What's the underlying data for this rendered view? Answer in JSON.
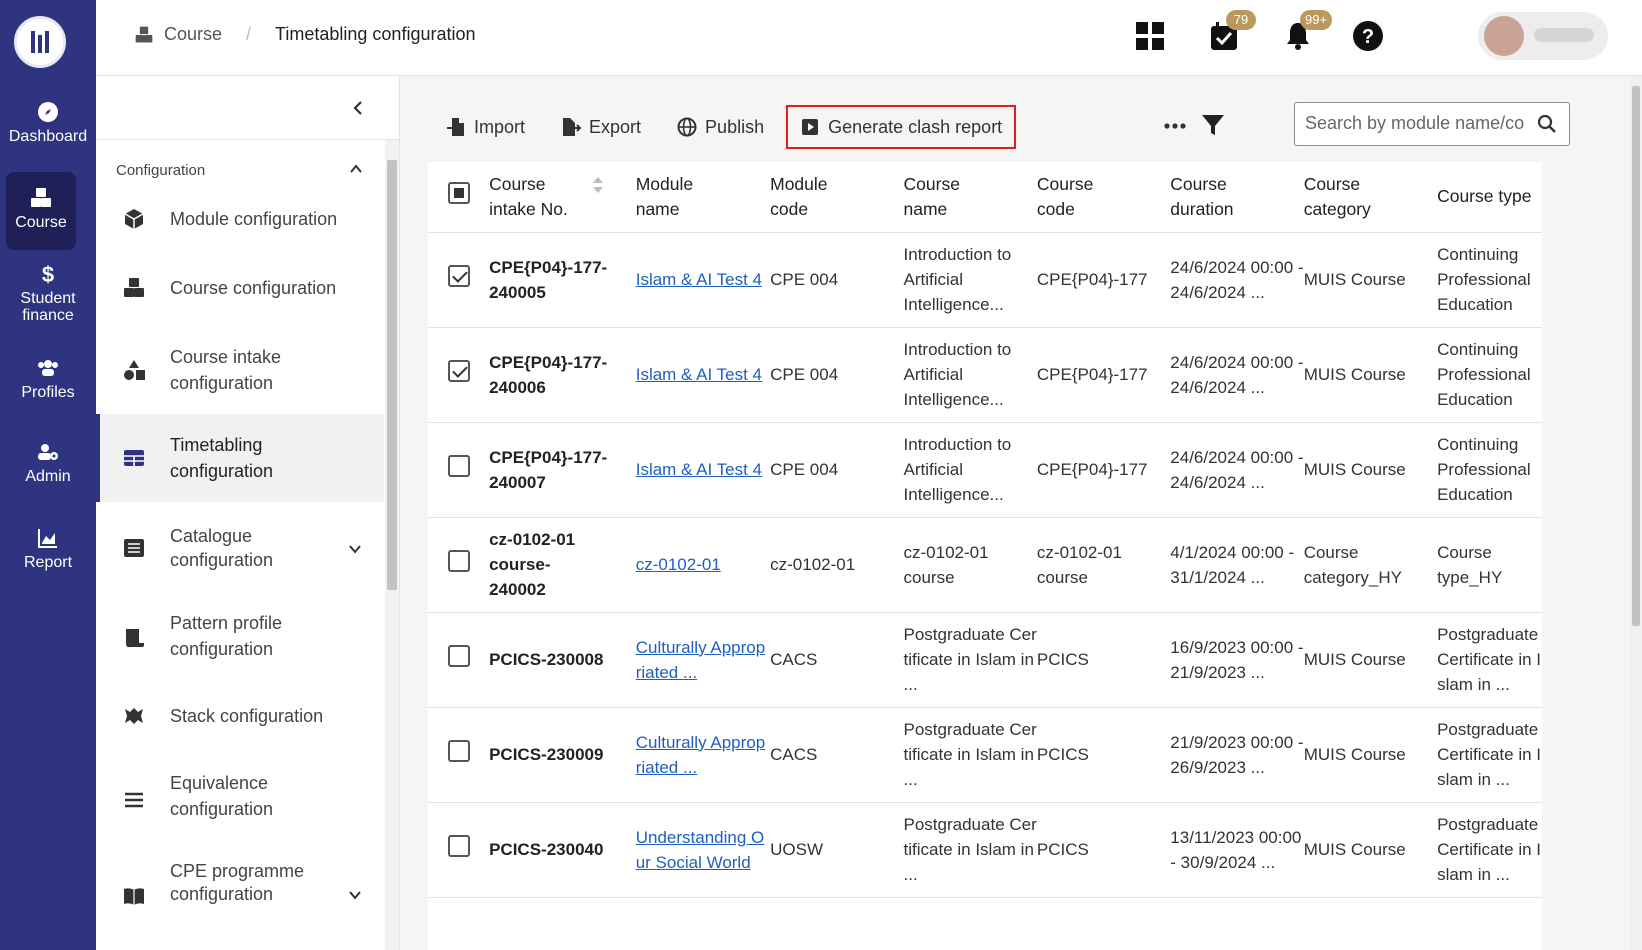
{
  "rail": {
    "items": [
      {
        "label": "Dashboard"
      },
      {
        "label": "Course"
      },
      {
        "label": "Student finance"
      },
      {
        "label": "Profiles"
      },
      {
        "label": "Admin"
      },
      {
        "label": "Report"
      }
    ]
  },
  "header": {
    "breadcrumb": [
      "Course",
      "Timetabling configuration"
    ],
    "calendar_badge": "79",
    "notification_badge": "99+"
  },
  "sidebar": {
    "section_title": "Configuration",
    "items": [
      {
        "label": "Module configuration"
      },
      {
        "label": "Course configuration"
      },
      {
        "label": "Course intake configuration"
      },
      {
        "label": "Timetabling configuration"
      },
      {
        "label": "Catalogue configuration"
      },
      {
        "label": "Pattern profile configuration"
      },
      {
        "label": "Stack configuration"
      },
      {
        "label": "Equivalence configuration"
      },
      {
        "label": "CPE programme configuration"
      }
    ]
  },
  "toolbar": {
    "import_label": "Import",
    "export_label": "Export",
    "publish_label": "Publish",
    "clash_label": "Generate clash report",
    "search_placeholder": "Search by module name/co..."
  },
  "table": {
    "columns": [
      "Course intake No.",
      "Module name",
      "Module code",
      "Course name",
      "Course code",
      "Course duration",
      "Course category",
      "Course type"
    ],
    "rows": [
      {
        "checked": true,
        "intake": "CPE{P04}-177-240005",
        "module_name": "Islam & AI Test 4",
        "module_code": "CPE 004",
        "course_name": "Introduction to Artificial Intelligence...",
        "course_code": "CPE{P04}-177",
        "duration": "24/6/2024 00:00 - 24/6/2024 ...",
        "category": "MUIS Course",
        "type": "Continuing Professional Education"
      },
      {
        "checked": true,
        "intake": "CPE{P04}-177-240006",
        "module_name": "Islam & AI Test 4",
        "module_code": "CPE 004",
        "course_name": "Introduction to Artificial Intelligence...",
        "course_code": "CPE{P04}-177",
        "duration": "24/6/2024 00:00 - 24/6/2024 ...",
        "category": "MUIS Course",
        "type": "Continuing Professional Education"
      },
      {
        "checked": false,
        "intake": "CPE{P04}-177-240007",
        "module_name": "Islam & AI Test 4",
        "module_code": "CPE 004",
        "course_name": "Introduction to Artificial Intelligence...",
        "course_code": "CPE{P04}-177",
        "duration": "24/6/2024 00:00 - 24/6/2024 ...",
        "category": "MUIS Course",
        "type": "Continuing Professional Education"
      },
      {
        "checked": false,
        "intake": "cz-0102-01 course-240002",
        "module_name": "cz-0102-01",
        "module_code": "cz-0102-01",
        "course_name": "cz-0102-01 course",
        "course_code": "cz-0102-01 course",
        "duration": "4/1/2024 00:00 - 31/1/2024 ...",
        "category": "Course category_HY",
        "type": "Course type_HY"
      },
      {
        "checked": false,
        "intake": "PCICS-230008",
        "module_name": "Culturally Appropriated ...",
        "module_code": "CACS",
        "course_name": "Postgraduate Certificate in Islam in ...",
        "course_code": "PCICS",
        "duration": "16/9/2023 00:00 - 21/9/2023 ...",
        "category": "MUIS Course",
        "type": "Postgraduate Certificate in Islam in ..."
      },
      {
        "checked": false,
        "intake": "PCICS-230009",
        "module_name": "Culturally Appropriated ...",
        "module_code": "CACS",
        "course_name": "Postgraduate Certificate in Islam in ...",
        "course_code": "PCICS",
        "duration": "21/9/2023 00:00 - 26/9/2023 ...",
        "category": "MUIS Course",
        "type": "Postgraduate Certificate in Islam in ..."
      },
      {
        "checked": false,
        "intake": "PCICS-230040",
        "module_name": "Understanding Our Social World",
        "module_code": "UOSW",
        "course_name": "Postgraduate Certificate in Islam in ...",
        "course_code": "PCICS",
        "duration": "13/11/2023 00:00 - 30/9/2024 ...",
        "category": "MUIS Course",
        "type": "Postgraduate Certificate in Islam in ..."
      }
    ]
  },
  "colors": {
    "rail_bg": "#2f3480",
    "rail_active": "#1e2057",
    "link": "#1f5fbf",
    "highlight_border": "#e02020",
    "badge": "#b99a5c"
  }
}
